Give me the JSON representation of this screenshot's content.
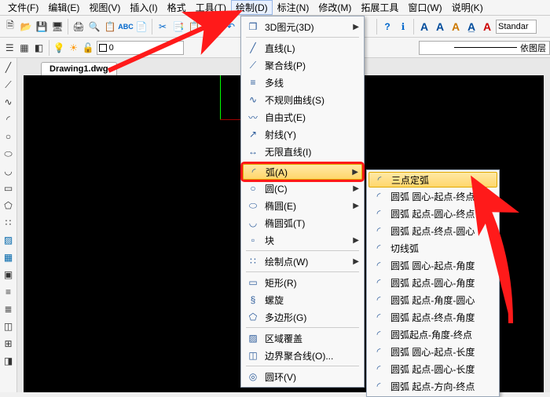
{
  "menubar": {
    "items": [
      "文件(F)",
      "编辑(E)",
      "视图(V)",
      "插入(I)",
      "格式",
      "工具(T)",
      "绘制(D)",
      "标注(N)",
      "修改(M)",
      "拓展工具",
      "窗口(W)",
      "说明(K)"
    ]
  },
  "toolbar1": {
    "icons": [
      "new",
      "open",
      "save",
      "saveall",
      "print",
      "print-preview",
      "find",
      "spell",
      "undo",
      "redo",
      "cut",
      "copy",
      "paste",
      "divider",
      "help",
      "info",
      "divider",
      "A",
      "A",
      "A-dim",
      "A-style",
      "A-multi"
    ],
    "styleText": "Standar"
  },
  "toolbar2": {
    "icons": [
      "pan",
      "zoom-window",
      "zoom-sel",
      "lightbulb",
      "sun",
      "layers",
      "square"
    ],
    "layerValue": "0",
    "bylayer": "依图层"
  },
  "tab": {
    "title": "Drawing1.dwg"
  },
  "leftTools": [
    "line",
    "polyline",
    "spline",
    "arc",
    "circle",
    "ellipse",
    "rect",
    "polygon",
    "text",
    "mtext",
    "hatch",
    "region",
    "table",
    "point",
    "block",
    "xref",
    "dim",
    "leader"
  ],
  "drawMenu": {
    "items": [
      {
        "icon": "cube",
        "label": "3D图元(3D)",
        "sub": true,
        "sep": true
      },
      {
        "icon": "line",
        "label": "直线(L)"
      },
      {
        "icon": "poly",
        "label": "聚合线(P)"
      },
      {
        "icon": "multi",
        "label": "多线"
      },
      {
        "icon": "spline",
        "label": "不规则曲线(S)"
      },
      {
        "icon": "free",
        "label": "自由式(E)"
      },
      {
        "icon": "ray",
        "label": "射线(Y)"
      },
      {
        "icon": "xline",
        "label": "无限直线(I)",
        "sep": true
      },
      {
        "icon": "arc",
        "label": "弧(A)",
        "sub": true,
        "hl": true
      },
      {
        "icon": "circle",
        "label": "圆(C)",
        "sub": true
      },
      {
        "icon": "ellipse",
        "label": "椭圆(E)",
        "sub": true
      },
      {
        "icon": "earc",
        "label": "椭圆弧(T)"
      },
      {
        "icon": "block",
        "label": "块",
        "sub": true,
        "sep": true
      },
      {
        "icon": "dpt",
        "label": "绘制点(W)",
        "sub": true,
        "sep": true
      },
      {
        "icon": "rect",
        "label": "矩形(R)"
      },
      {
        "icon": "helix",
        "label": "螺旋"
      },
      {
        "icon": "polyg",
        "label": "多边形(G)",
        "sep": true
      },
      {
        "icon": "region",
        "label": "区域覆盖"
      },
      {
        "icon": "bpoly",
        "label": "边界聚合线(O)...",
        "sep": true
      },
      {
        "icon": "ring",
        "label": "圆环(V)"
      }
    ]
  },
  "arcMenu": {
    "items": [
      {
        "icon": "a3",
        "label": "三点定弧",
        "hl": true
      },
      {
        "icon": "a",
        "label": "圆弧 圆心-起点-终点"
      },
      {
        "icon": "a",
        "label": "圆弧 起点-圆心-终点"
      },
      {
        "icon": "a",
        "label": "圆弧 起点-终点-圆心"
      },
      {
        "icon": "a",
        "label": "切线弧"
      },
      {
        "icon": "a",
        "label": "圆弧 圆心-起点-角度"
      },
      {
        "icon": "a",
        "label": "圆弧 起点-圆心-角度"
      },
      {
        "icon": "a",
        "label": "圆弧 起点-角度-圆心"
      },
      {
        "icon": "a",
        "label": "圆弧 起点-终点-角度"
      },
      {
        "icon": "a",
        "label": "圆弧起点-角度-终点"
      },
      {
        "icon": "a",
        "label": "圆弧 圆心-起点-长度"
      },
      {
        "icon": "a",
        "label": "圆弧 起点-圆心-长度"
      },
      {
        "icon": "a",
        "label": "圆弧 起点-方向-终点"
      }
    ]
  }
}
